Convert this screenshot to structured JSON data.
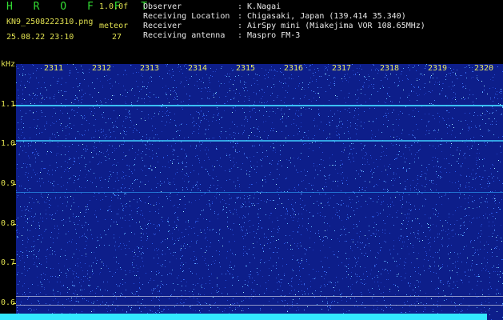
{
  "header": {
    "brand": "H R O F F T",
    "version": "1.0.0f",
    "filename": "KN9_2508222310.png",
    "meteor_label": "meteor",
    "datetime": "25.08.22 23:10",
    "meteor_count": "27"
  },
  "info": [
    {
      "key": "Observer",
      "value": ": K.Nagai"
    },
    {
      "key": "Receiving Location",
      "value": ": Chigasaki, Japan (139.414 35.340)"
    },
    {
      "key": "Receiver",
      "value": ": AirSpy mini (Miakejima VOR 108.65MHz)"
    },
    {
      "key": "Receiving antenna",
      "value": ": Maspro FM-3"
    }
  ],
  "y_axis": {
    "unit": "kHz",
    "ticks": [
      "1.1",
      "1.0",
      "0.9",
      "0.8",
      "0.7",
      "0.6"
    ]
  },
  "x_axis": {
    "ticks": [
      "2311",
      "2312",
      "2313",
      "2314",
      "2315",
      "2316",
      "2317",
      "2318",
      "2319",
      "2320"
    ]
  },
  "colors": {
    "background": "#0d1e8a",
    "signal": "#33e8ff",
    "label": "#e0e050",
    "brand": "#33dd33"
  }
}
